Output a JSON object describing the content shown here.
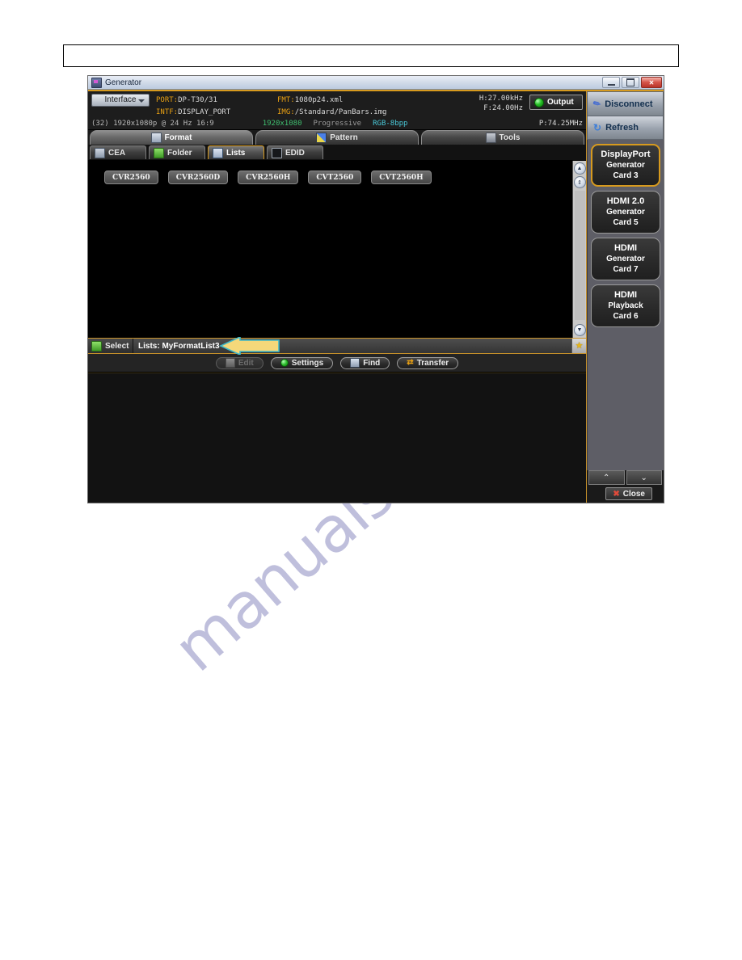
{
  "window": {
    "title": "Generator",
    "icon": "generator-app-icon",
    "controls": {
      "minimize": "–",
      "maximize": "□",
      "close": "✕"
    }
  },
  "status": {
    "interface_button": "Interface",
    "port_label": "PORT:",
    "port_value": "DP-T30/31",
    "intf_label": "INTF:",
    "intf_value": "DISPLAY_PORT",
    "fmt_label": "FMT:",
    "fmt_value": "1080p24.xml",
    "img_label": "IMG:",
    "img_value": "/Standard/PanBars.img",
    "h_freq": "H:27.00kHz",
    "v_freq": "F:24.00Hz",
    "pixel_clock": "P:74.25MHz",
    "output_button": "Output",
    "format_summary": "(32) 1920x1080p @ 24 Hz 16:9",
    "resolution": "1920x1080",
    "scan": "Progressive",
    "color": "RGB-8bpp"
  },
  "tabs": [
    {
      "label": "Format",
      "icon": "format-icon",
      "selected": true
    },
    {
      "label": "Pattern",
      "icon": "pattern-icon",
      "selected": false
    },
    {
      "label": "Tools",
      "icon": "tools-icon",
      "selected": false
    }
  ],
  "subtabs": [
    {
      "label": "CEA",
      "icon": "cea-icon",
      "selected": false
    },
    {
      "label": "Folder",
      "icon": "folder-icon",
      "selected": false
    },
    {
      "label": "Lists",
      "icon": "lists-icon",
      "selected": true
    },
    {
      "label": "EDID",
      "icon": "edid-icon",
      "selected": false
    }
  ],
  "formats": [
    {
      "label": "CVR2560"
    },
    {
      "label": "CVR2560D"
    },
    {
      "label": "CVR2560H"
    },
    {
      "label": "CVT2560"
    },
    {
      "label": "CVT2560H"
    }
  ],
  "scrollbar": {
    "up": "▲",
    "page": "⇕",
    "down": "▼"
  },
  "lists_bar": {
    "select_label": "Select",
    "select_icon": "folder-icon",
    "value": "Lists: MyFormatList3",
    "star_icon": "star-icon"
  },
  "actions": [
    {
      "label": "Edit",
      "icon": "edit-icon",
      "disabled": true
    },
    {
      "label": "Settings",
      "icon": "settings-led-icon",
      "disabled": false
    },
    {
      "label": "Find",
      "icon": "find-icon",
      "disabled": false
    },
    {
      "label": "Transfer",
      "icon": "transfer-icon",
      "disabled": false
    }
  ],
  "side": {
    "disconnect": {
      "label": "Disconnect",
      "icon": "disconnect-icon"
    },
    "refresh": {
      "label": "Refresh",
      "icon": "refresh-icon"
    },
    "cards": [
      {
        "line1": "DisplayPort",
        "line2": "Generator",
        "line3": "Card 3",
        "selected": true
      },
      {
        "line1": "HDMI 2.0",
        "line2": "Generator",
        "line3": "Card 5",
        "selected": false
      },
      {
        "line1": "HDMI",
        "line2": "Generator",
        "line3": "Card 7",
        "selected": false
      },
      {
        "line1": "HDMI",
        "line2": "Playback",
        "line3": "Card 6",
        "selected": false
      }
    ],
    "nav_up": "⌃",
    "nav_down": "⌄",
    "close": {
      "label": "Close",
      "icon": "close-x-icon"
    }
  },
  "annotation": {
    "type": "left-arrow",
    "color": "#f5d87a"
  },
  "watermark": {
    "text": "manualslive.com",
    "color": "#2e2e8f"
  },
  "colors": {
    "accent_orange": "#d79a1e",
    "label_orange": "#e8a013",
    "green": "#3fbf6f",
    "cyan": "#49c8d8"
  }
}
